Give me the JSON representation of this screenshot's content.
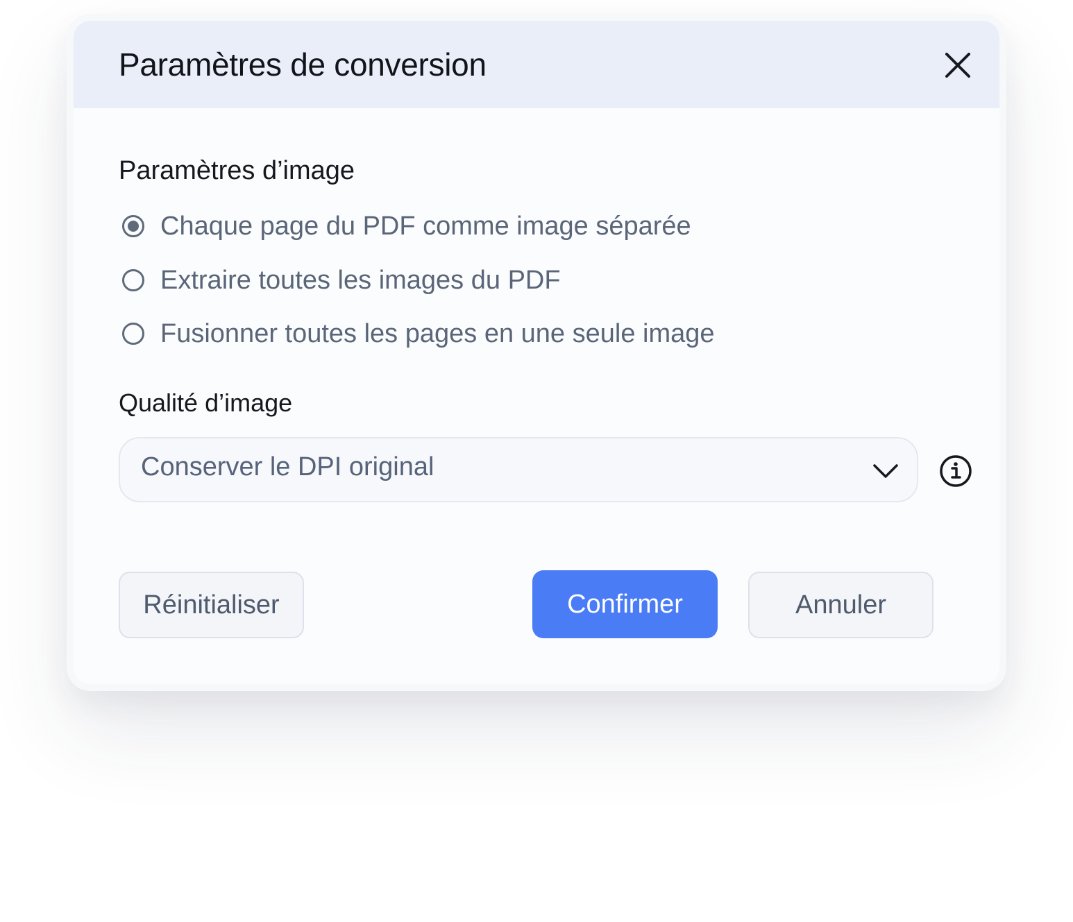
{
  "dialog": {
    "title": "Paramètres de conversion",
    "close_icon": "close-icon"
  },
  "image_settings": {
    "heading": "Paramètres d’image",
    "options": [
      {
        "label": "Chaque page du PDF comme image séparée",
        "selected": true
      },
      {
        "label": "Extraire toutes les images du PDF",
        "selected": false
      },
      {
        "label": "Fusionner toutes les pages en une seule image",
        "selected": false
      }
    ]
  },
  "image_quality": {
    "heading": "Qualité d’image",
    "selected_value": "Conserver le DPI original",
    "chevron_icon": "chevron-down-icon",
    "info_icon": "info-icon"
  },
  "actions": {
    "reset_label": "Réinitialiser",
    "confirm_label": "Confirmer",
    "cancel_label": "Annuler"
  },
  "colors": {
    "header_background": "#e9eef9",
    "primary_button": "#4a7cf6",
    "muted_text": "#5a6678"
  }
}
